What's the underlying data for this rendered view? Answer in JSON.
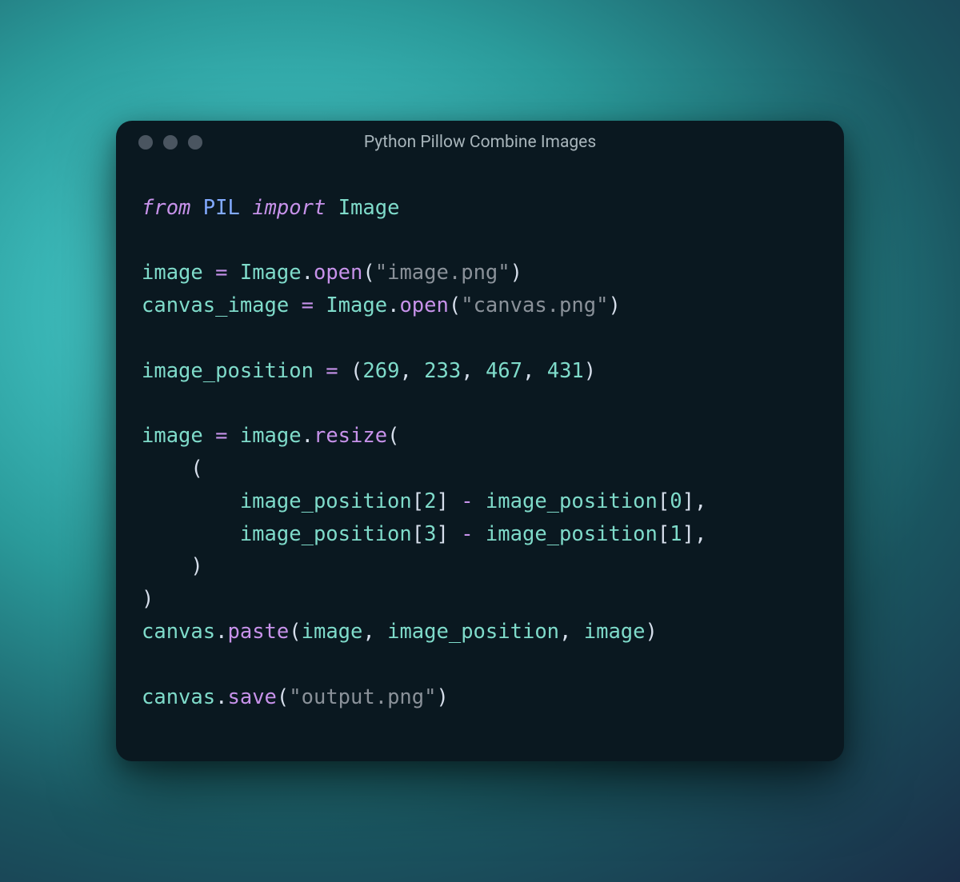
{
  "window": {
    "title": "Python Pillow Combine Images"
  },
  "code": {
    "kw_from": "from",
    "module": "PIL",
    "kw_import": "import",
    "import_name": "Image",
    "v_image": "image",
    "v_canvas_image": "canvas_image",
    "v_canvas": "canvas",
    "v_image_position": "image_position",
    "cls_image": "Image",
    "fn_open": "open",
    "fn_resize": "resize",
    "fn_paste": "paste",
    "fn_save": "save",
    "str_image_png": "\"image.png\"",
    "str_canvas_png": "\"canvas.png\"",
    "str_output_png": "\"output.png\"",
    "n_269": "269",
    "n_233": "233",
    "n_467": "467",
    "n_431": "431",
    "n_0": "0",
    "n_1": "1",
    "n_2": "2",
    "n_3": "3",
    "eq": "=",
    "minus": "-",
    "dot": ".",
    "comma": ",",
    "lp": "(",
    "rp": ")",
    "lb": "[",
    "rb": "]",
    "sp": " ",
    "indent1": "    ",
    "indent2": "        "
  }
}
